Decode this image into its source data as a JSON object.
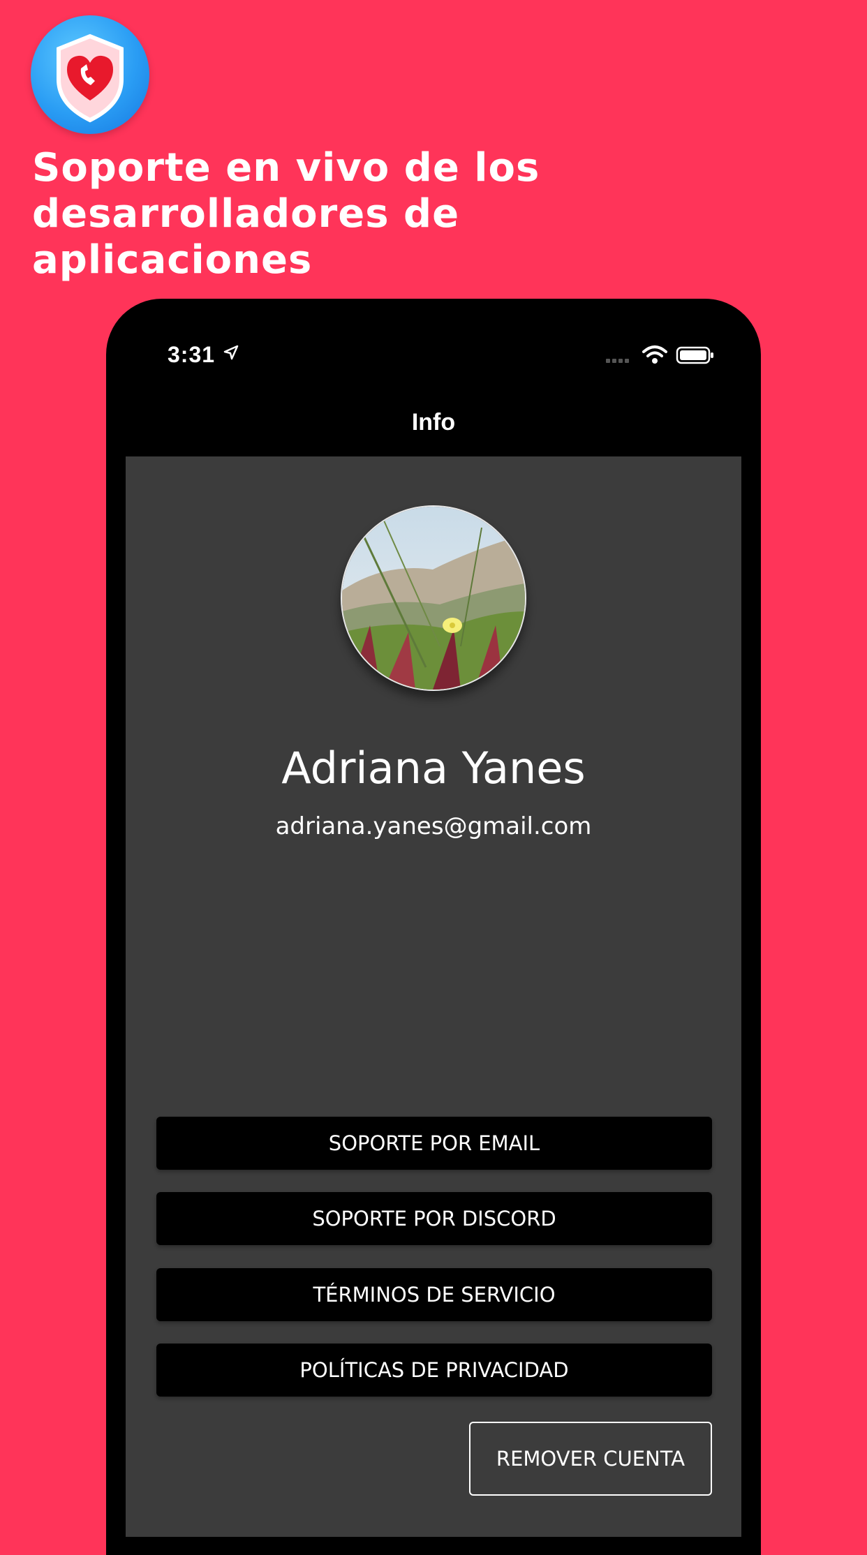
{
  "headline": {
    "line1": "Soporte en vivo de los",
    "line2": "desarrolladores de",
    "line3": "aplicaciones"
  },
  "app_icon": "shield-heart-phone-icon",
  "status_bar": {
    "time": "3:31",
    "icons": [
      "location-arrow-icon",
      "cellular-signal-icon",
      "wifi-icon",
      "battery-icon"
    ]
  },
  "nav": {
    "title": "Info"
  },
  "profile": {
    "name": "Adriana Yanes",
    "email": "adriana.yanes@gmail.com",
    "avatar": "avatar-photo"
  },
  "buttons": {
    "email_support": "SOPORTE POR EMAIL",
    "discord_support": "SOPORTE POR DISCORD",
    "terms": "TÉRMINOS DE SERVICIO",
    "privacy": "POLÍTICAS DE PRIVACIDAD",
    "remove_account": "REMOVER CUENTA"
  },
  "colors": {
    "background": "#FF3459",
    "panel": "#3c3c3c",
    "button": "#000000",
    "text": "#ffffff"
  }
}
